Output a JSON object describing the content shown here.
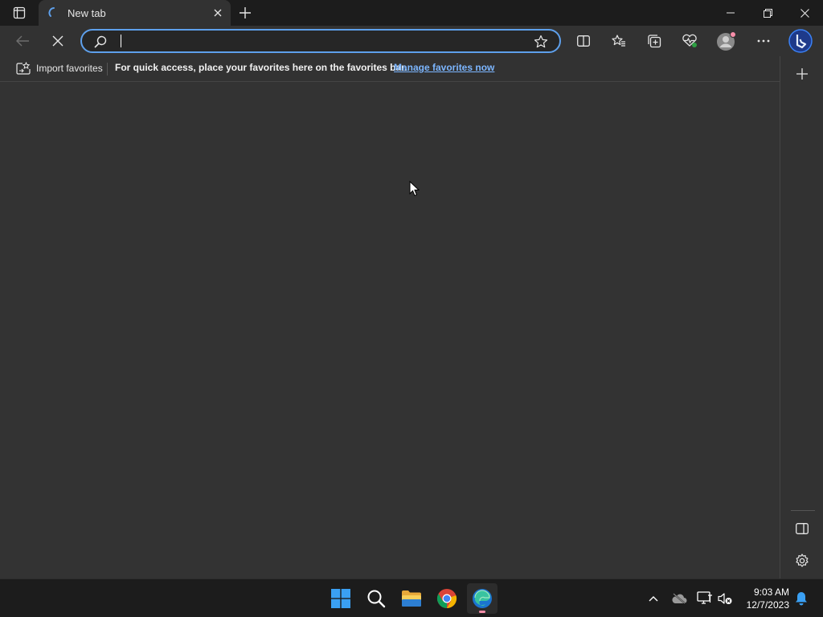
{
  "tab": {
    "title": "New tab",
    "favicon": "loading-edge-icon"
  },
  "address_bar": {
    "value": "",
    "placeholder": ""
  },
  "favorites_bar": {
    "import_label": "Import favorites",
    "hint": "For quick access, place your favorites here on the favorites bar.",
    "manage_link": "Manage favorites now"
  },
  "toolbar": {
    "icons": [
      "back-icon",
      "stop-loading-icon",
      "split-screen-icon",
      "favorites-icon",
      "collections-icon",
      "browser-essentials-icon",
      "profile-avatar",
      "more-icon",
      "bing-copilot-icon"
    ]
  },
  "sidebar": {
    "icons": [
      "add-icon",
      "hide-sidebar-icon",
      "settings-icon"
    ]
  },
  "taskbar": {
    "apps": [
      "windows-start-icon",
      "search-icon",
      "file-explorer-icon",
      "chrome-icon",
      "edge-icon"
    ],
    "tray": [
      "chevron-up-icon",
      "onedrive-icon",
      "network-icon",
      "volume-muted-icon",
      "notification-bell-icon"
    ],
    "time": "9:03 AM",
    "date": "12/7/2023"
  },
  "colors": {
    "accent": "#5ea0ec",
    "link": "#7cb6ff",
    "content_bg": "#333333"
  }
}
